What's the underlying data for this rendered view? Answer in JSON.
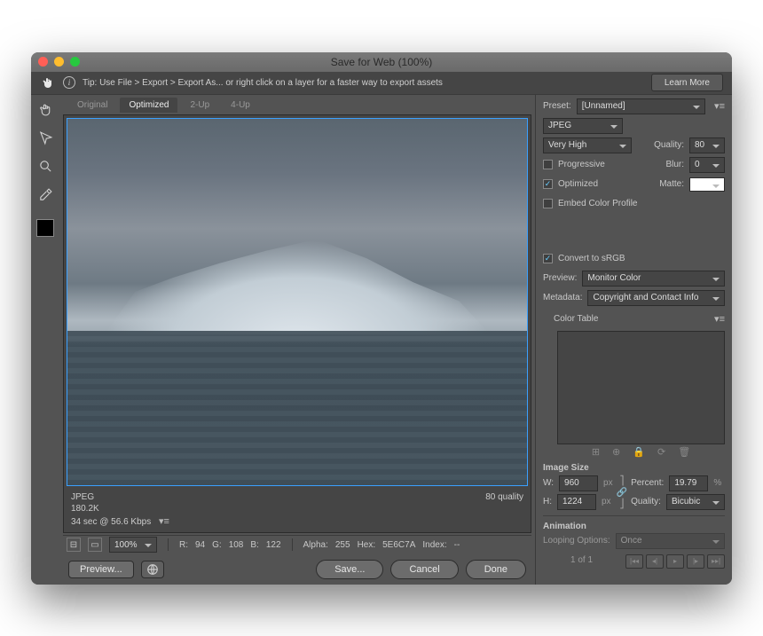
{
  "titlebar": {
    "title": "Save for Web (100%)"
  },
  "tipbar": {
    "text": "Tip: Use File > Export > Export As...  or right click on a layer for a faster way to export assets",
    "learn": "Learn More"
  },
  "tabs": {
    "items": [
      "Original",
      "Optimized",
      "2-Up",
      "4-Up"
    ],
    "active_index": 1
  },
  "preview_info": {
    "format": "JPEG",
    "size": "180.2K",
    "time": "34 sec @ 56.6 Kbps",
    "quality": "80 quality"
  },
  "status": {
    "zoom": "100%",
    "r_label": "R:",
    "r": "94",
    "g_label": "G:",
    "g": "108",
    "b_label": "B:",
    "b": "122",
    "alpha_label": "Alpha:",
    "alpha": "255",
    "hex_label": "Hex:",
    "hex": "5E6C7A",
    "index_label": "Index:",
    "index": "--"
  },
  "settings": {
    "preset_label": "Preset:",
    "preset_value": "[Unnamed]",
    "format": "JPEG",
    "quality_preset": "Very High",
    "quality_label": "Quality:",
    "quality_value": "80",
    "progressive_label": "Progressive",
    "progressive_on": false,
    "blur_label": "Blur:",
    "blur_value": "0",
    "optimized_label": "Optimized",
    "optimized_on": true,
    "matte_label": "Matte:",
    "embed_label": "Embed Color Profile",
    "embed_on": false,
    "convert_label": "Convert to sRGB",
    "convert_on": true,
    "preview_label": "Preview:",
    "preview_value": "Monitor Color",
    "metadata_label": "Metadata:",
    "metadata_value": "Copyright and Contact Info",
    "color_table_label": "Color Table"
  },
  "image_size": {
    "header": "Image Size",
    "w_label": "W:",
    "w": "960",
    "w_unit": "px",
    "h_label": "H:",
    "h": "1224",
    "h_unit": "px",
    "percent_label": "Percent:",
    "percent": "19.79",
    "percent_unit": "%",
    "quality_label": "Quality:",
    "quality_value": "Bicubic"
  },
  "animation": {
    "header": "Animation",
    "looping_label": "Looping Options:",
    "looping_value": "Once",
    "frame": "1 of 1"
  },
  "buttons": {
    "preview": "Preview...",
    "save": "Save...",
    "cancel": "Cancel",
    "done": "Done"
  }
}
